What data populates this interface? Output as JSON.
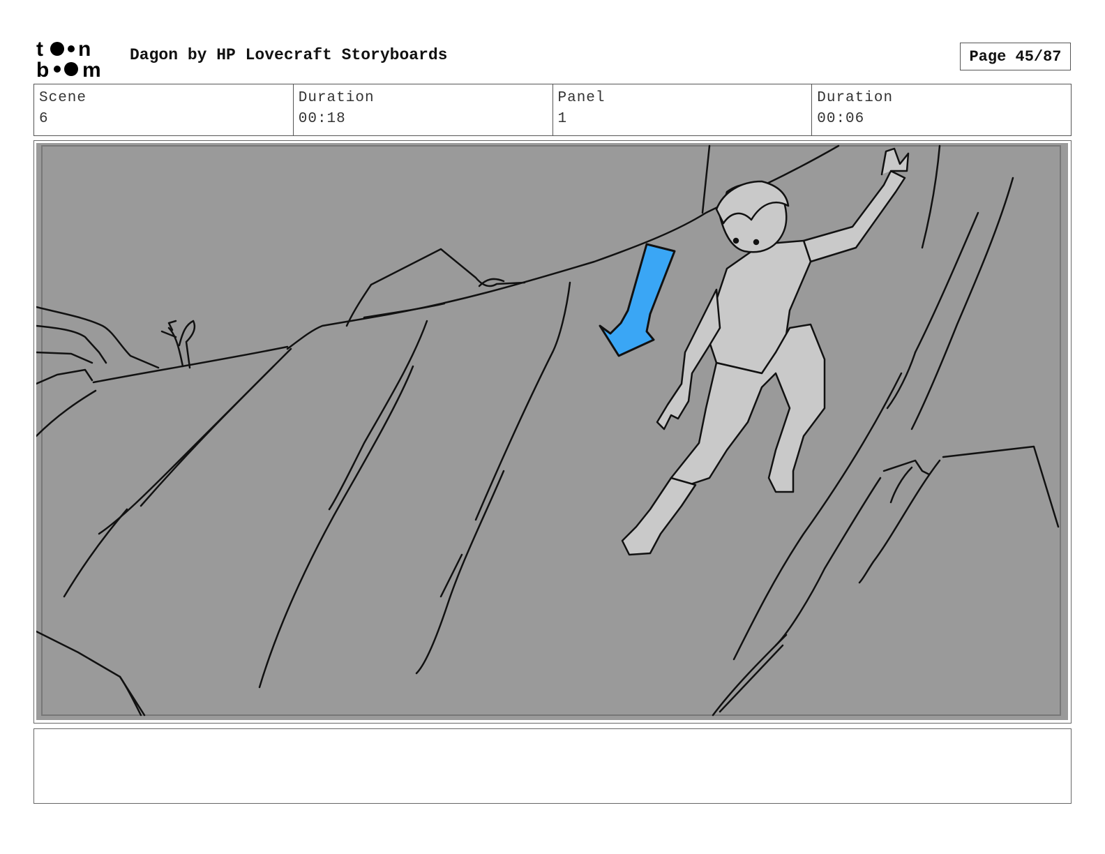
{
  "header": {
    "logo_text": "toon boom",
    "title": "Dagon by HP Lovecraft Storyboards",
    "page": "Page 45/87"
  },
  "info": {
    "scene_label": "Scene",
    "scene_value": "6",
    "scene_duration_label": "Duration",
    "scene_duration_value": "00:18",
    "panel_label": "Panel",
    "panel_value": "1",
    "panel_duration_label": "Duration",
    "panel_duration_value": "00:06"
  },
  "panel": {
    "background_color": "#9a9a9a",
    "figure_color": "#c9c9c9",
    "arrow_color": "#3aa6f5",
    "arrow_direction": "down-left"
  },
  "notes": {
    "text": ""
  }
}
